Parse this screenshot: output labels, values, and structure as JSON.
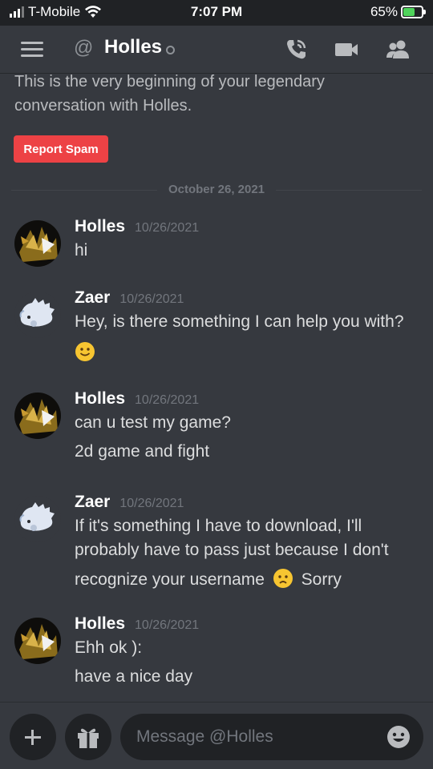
{
  "status_bar": {
    "carrier": "T-Mobile",
    "time": "7:07 PM",
    "battery_percent": "65%",
    "battery_level": 0.65
  },
  "header": {
    "at_symbol": "@",
    "title": "Holles",
    "icons": [
      "hamburger-icon",
      "phone-call-icon",
      "video-camera-icon",
      "members-icon"
    ]
  },
  "intro": {
    "text": "This is the very beginning of your legendary conversation with Holles.",
    "report_label": "Report Spam"
  },
  "divider": {
    "date": "October 26, 2021"
  },
  "messages": [
    {
      "author": "Holles",
      "timestamp": "10/26/2021",
      "lines": [
        "hi"
      ]
    },
    {
      "author": "Zaer",
      "timestamp": "10/26/2021",
      "lines": [
        "Hey, is there something I can help you with?",
        "🙂"
      ]
    },
    {
      "author": "Holles",
      "timestamp": "10/26/2021",
      "lines": [
        "can u test my game?",
        "2d game and fight"
      ]
    },
    {
      "author": "Zaer",
      "timestamp": "10/26/2021",
      "lines": [
        "If it's something I have to download, I'll",
        "probably have to pass just because I don't",
        "recognize your username",
        "Sorry"
      ]
    },
    {
      "author": "Holles",
      "timestamp": "10/26/2021",
      "lines": [
        "Ehh ok ):",
        "have a nice day"
      ]
    }
  ],
  "composer": {
    "placeholder": "Message @Holles",
    "icons": [
      "plus-icon",
      "gift-icon",
      "emoji-icon"
    ]
  },
  "colors": {
    "background": "#36393f",
    "danger": "#ed4245",
    "muted": "#72767d",
    "battery_green": "#4fd35b",
    "emoji_yellow": "#f7c531"
  }
}
